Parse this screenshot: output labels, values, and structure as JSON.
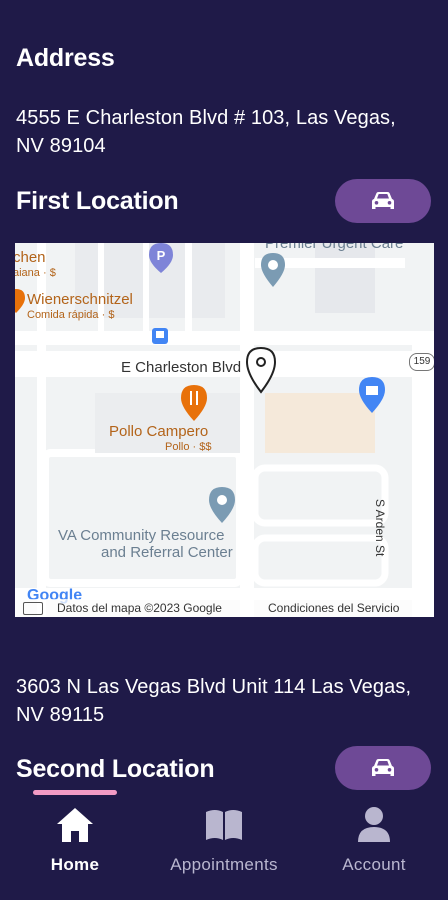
{
  "address_section": {
    "title": "Address",
    "line": "4555 E Charleston Blvd # 103, Las Vegas, NV 89104"
  },
  "first_location": {
    "title": "First Location",
    "drive_icon": "car-icon"
  },
  "map": {
    "street": "E Charleston Blvd",
    "poi_urgent": "Premier Urgent Care",
    "poi_kitchen": "chen",
    "poi_kitchen_sub": "aiana · $",
    "poi_wiener": "Wienerschnitzel",
    "poi_wiener_sub": "Comida rápida · $",
    "poi_pollo": "Pollo Campero",
    "poi_pollo_sub": "Pollo · $$",
    "poi_va_1": "VA Community Resource",
    "poi_va_2": "and Referral Center",
    "side_street": "S Arden St",
    "route_badge": "159",
    "logo": "Google",
    "data_notice": "Datos del mapa ©2023 Google",
    "terms": "Condiciones del Servicio",
    "colors": {
      "land": "#f1f3f4",
      "road": "#ffffff",
      "poi_orange": "#e8710a",
      "poi_blue": "#4285f4",
      "poi_gray": "#7b9bb3"
    }
  },
  "second_address": {
    "line": "3603 N Las Vegas Blvd Unit 114 Las Vegas, NV 89115"
  },
  "second_location": {
    "title": "Second Location",
    "drive_icon": "car-icon"
  },
  "bottom_nav": {
    "items": [
      {
        "label": "Home",
        "icon": "home-icon",
        "active": true
      },
      {
        "label": "Appointments",
        "icon": "book-icon",
        "active": false
      },
      {
        "label": "Account",
        "icon": "person-icon",
        "active": false
      }
    ],
    "active_color": "#ffffff",
    "inactive_color": "#b9b6cf",
    "indicator_color": "#f29bc4"
  },
  "theme": {
    "background": "#1f1a48",
    "button": "#6e4996"
  }
}
